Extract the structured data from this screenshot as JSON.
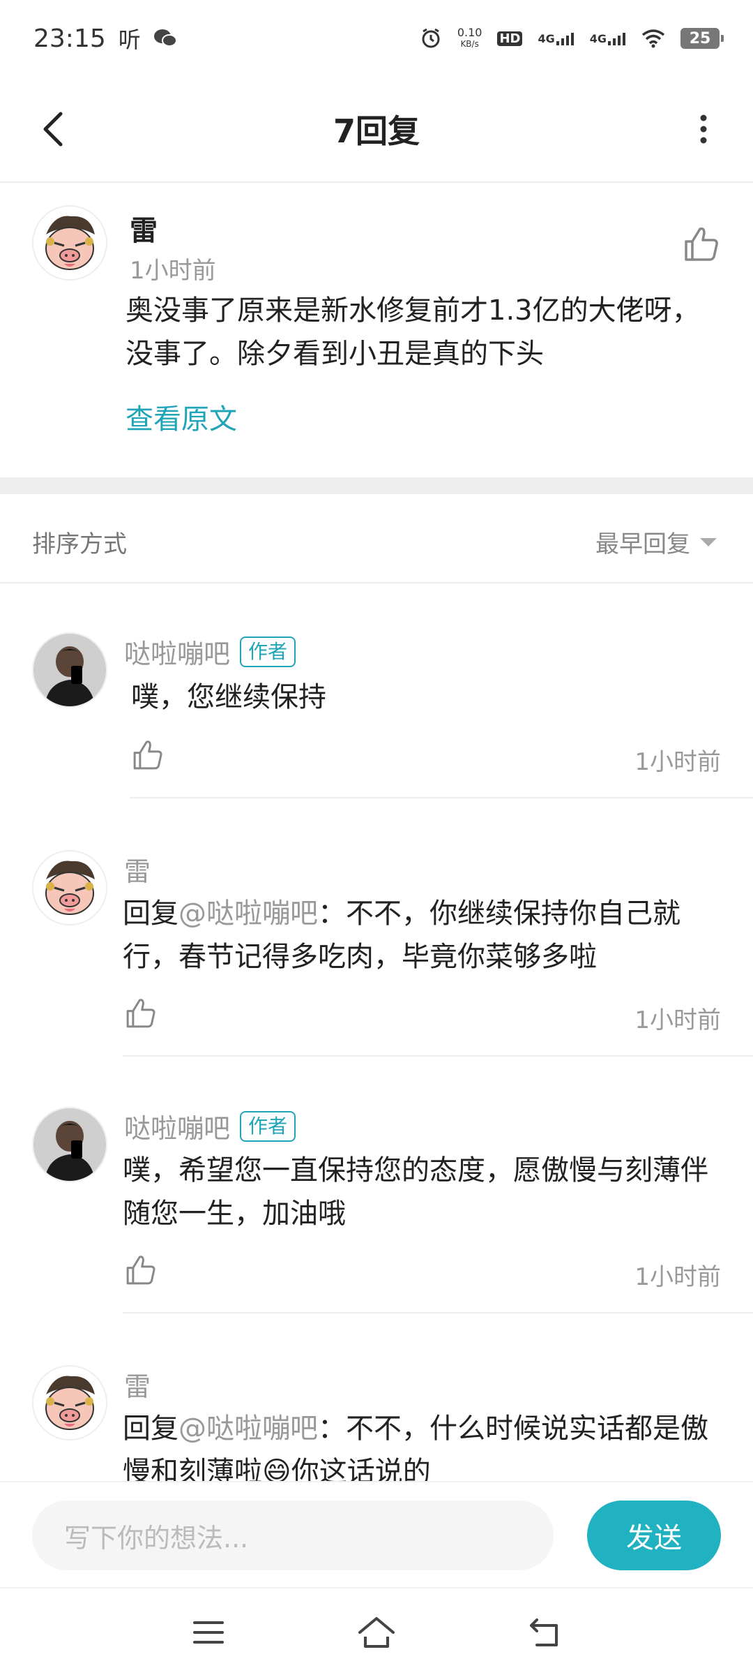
{
  "status_bar": {
    "time": "23:15",
    "listen_label": "听",
    "net_speed_top": "0.10",
    "net_speed_bottom": "KB/s",
    "hd_label": "HD",
    "signal1_label": "4G",
    "signal2_label": "4G",
    "battery": "25"
  },
  "header": {
    "title": "7回复"
  },
  "original_comment": {
    "username": "雷",
    "time": "1小时前",
    "text": "奥没事了原来是新水修复前才1.3亿的大佬呀，没事了。除夕看到小丑是真的下头",
    "view_original": "查看原文"
  },
  "sort": {
    "label": "排序方式",
    "value": "最早回复"
  },
  "replies": [
    {
      "username": "哒啦嘣吧",
      "badge": "作者",
      "reply_prefix": "",
      "mention": "",
      "text": "噗，您继续保持",
      "time": "1小时前"
    },
    {
      "username": "雷",
      "badge": "",
      "reply_prefix": "回复",
      "mention": "@哒啦嘣吧",
      "text": "：不不，你继续保持你自己就行，春节记得多吃肉，毕竟你菜够多啦",
      "time": "1小时前"
    },
    {
      "username": "哒啦嘣吧",
      "badge": "作者",
      "reply_prefix": "",
      "mention": "",
      "text": "噗，希望您一直保持您的态度，愿傲慢与刻薄伴随您一生，加油哦",
      "time": "1小时前"
    },
    {
      "username": "雷",
      "badge": "",
      "reply_prefix": "回复",
      "mention": "@哒啦嘣吧",
      "text": "：不不，什么时候说实话都是傲慢和刻薄啦😄你这话说的",
      "time": ""
    }
  ],
  "composer": {
    "placeholder": "写下你的想法...",
    "send_label": "发送"
  },
  "colors": {
    "accent": "#20a5b8",
    "send_button": "#20b2c0",
    "muted_text": "#999999",
    "divider": "#eeeeee"
  },
  "icons": {
    "back": "back-arrow-icon",
    "more": "more-vertical-icon",
    "like": "thumbs-up-icon",
    "sort": "triangle-down-icon",
    "nav_menu": "menu-icon",
    "nav_home": "home-icon",
    "nav_back": "return-icon"
  }
}
